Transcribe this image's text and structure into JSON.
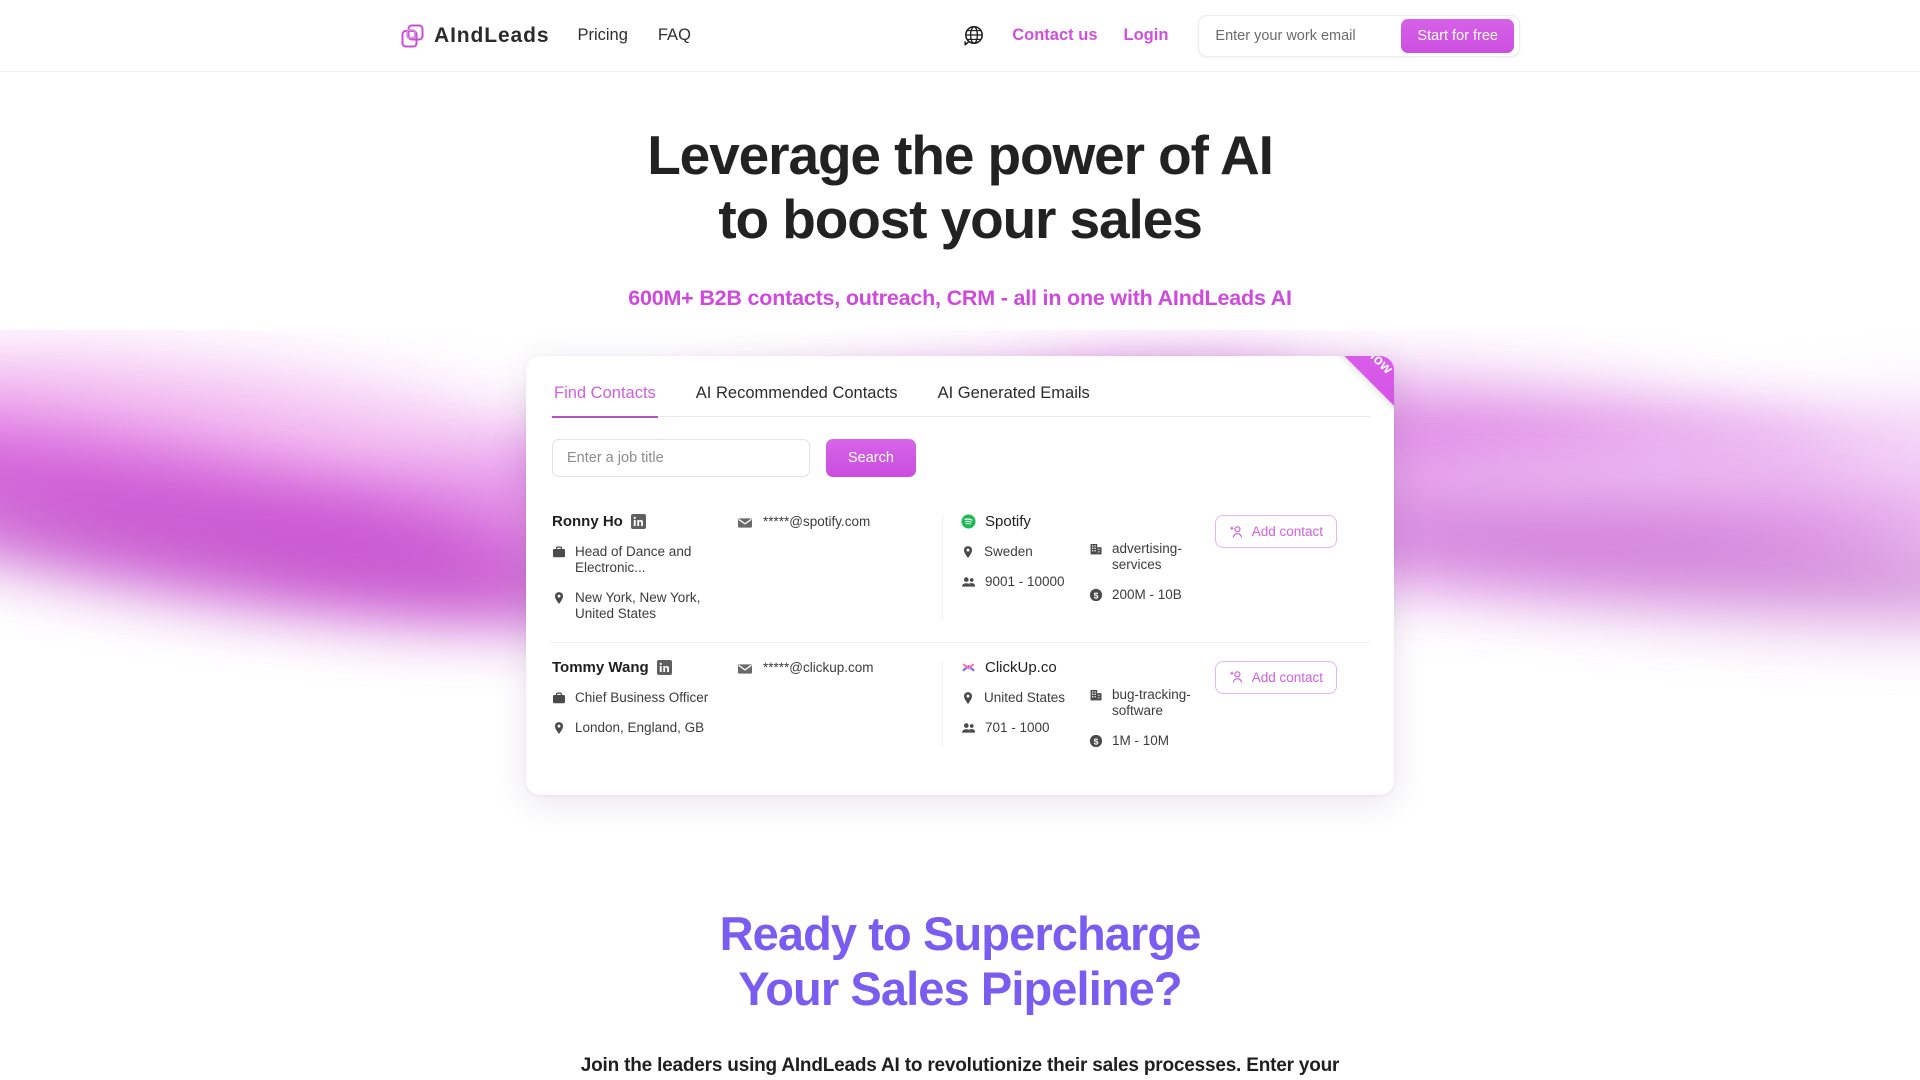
{
  "header": {
    "brand_name": "AIndLeads",
    "logo_icon": "stacked-squares-icon",
    "nav": [
      {
        "label": "Pricing"
      },
      {
        "label": "FAQ"
      }
    ],
    "globe_icon": "globe-chat-icon",
    "contact_label": "Contact us",
    "login_label": "Login",
    "email_placeholder": "Enter your work email",
    "email_value": "",
    "cta_label": "Start for free"
  },
  "hero": {
    "title_line1": "Leverage the power of AI",
    "title_line2": "to boost your sales",
    "subtitle": "600M+ B2B contacts, outreach, CRM - all in one with AIndLeads AI"
  },
  "card": {
    "ribbon_label": "Try it now",
    "tabs": [
      {
        "label": "Find Contacts",
        "active": true
      },
      {
        "label": "AI Recommended Contacts",
        "active": false
      },
      {
        "label": "AI Generated Emails",
        "active": false
      }
    ],
    "search": {
      "placeholder": "Enter a job title",
      "value": "",
      "button_label": "Search"
    },
    "add_contact_label": "Add contact",
    "results": [
      {
        "name": "Ronny Ho",
        "linkedin_icon": "linkedin-icon",
        "title_icon": "briefcase-icon",
        "title": "Head of Dance and Electronic...",
        "location_icon": "map-pin-icon",
        "location": "New York, New York, United States",
        "email_icon": "envelope-icon",
        "email": "*****@spotify.com",
        "company_icon": "spotify-icon",
        "company": "Spotify",
        "company_location_icon": "map-pin-icon",
        "company_location": "Sweden",
        "headcount_icon": "people-icon",
        "headcount": "9001 - 10000",
        "industry_icon": "building-icon",
        "industry": "advertising-services",
        "revenue_icon": "dollar-coin-icon",
        "revenue": "200M - 10B"
      },
      {
        "name": "Tommy Wang",
        "linkedin_icon": "linkedin-icon",
        "title_icon": "briefcase-icon",
        "title": "Chief Business Officer",
        "location_icon": "map-pin-icon",
        "location": "London, England, GB",
        "email_icon": "envelope-icon",
        "email": "*****@clickup.com",
        "company_icon": "clickup-icon",
        "company": "ClickUp.co",
        "company_location_icon": "map-pin-icon",
        "company_location": "United States",
        "headcount_icon": "people-icon",
        "headcount": "701 - 1000",
        "industry_icon": "building-icon",
        "industry": "bug-tracking-software",
        "revenue_icon": "dollar-coin-icon",
        "revenue": "1M - 10M"
      }
    ]
  },
  "cta": {
    "title_line1": "Ready to Supercharge",
    "title_line2": "Your Sales Pipeline?",
    "subtitle": "Join the leaders using AIndLeads AI to revolutionize their sales processes. Enter your"
  },
  "colors": {
    "accent_magenta": "#d14fdd",
    "accent_purple": "#7a5cf0",
    "text_dark": "#222222",
    "spotify_green": "#1db954"
  }
}
